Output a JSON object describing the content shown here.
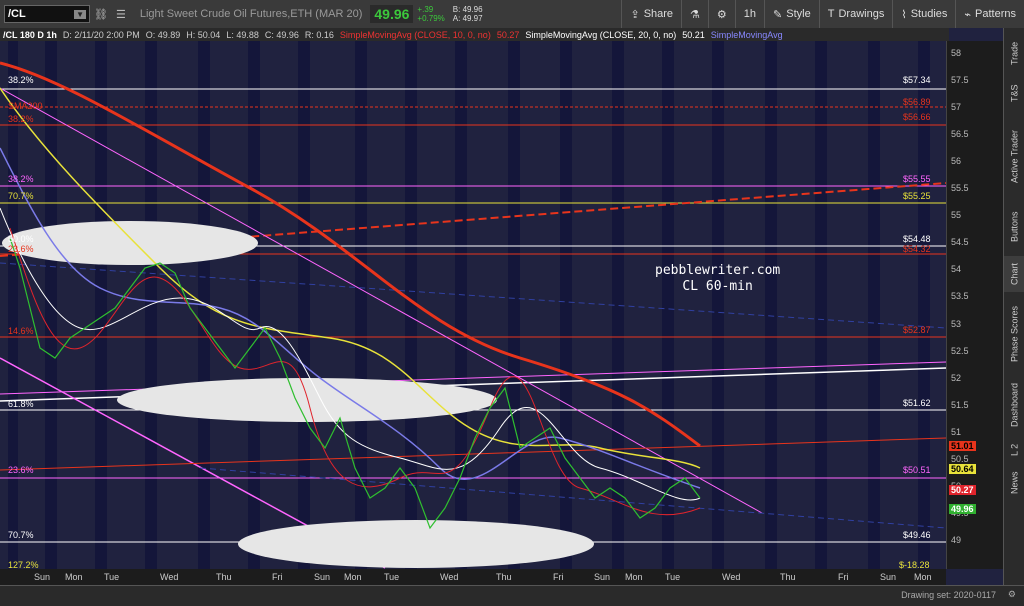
{
  "toolbar": {
    "symbol": "/CL",
    "description": "Light Sweet Crude Oil Futures,ETH (MAR 20)",
    "last_price": "49.96",
    "change": "+.39",
    "change_pct": "+0.79%",
    "bid": "B: 49.96",
    "ask": "A: 49.97",
    "share_label": "Share",
    "interval_label": "1h",
    "style_label": "Style",
    "drawings_label": "Drawings",
    "studies_label": "Studies",
    "patterns_label": "Patterns"
  },
  "header": {
    "title": "/CL 180 D 1h",
    "date": "D: 2/11/20 2:00 PM",
    "open": "O: 49.89",
    "high": "H: 50.04",
    "low": "L: 49.88",
    "close": "C: 49.96",
    "range": "R: 0.16",
    "sma10": "SimpleMovingAvg (CLOSE, 10, 0, no)",
    "sma10_val": "50.27",
    "sma20": "SimpleMovingAvg (CLOSE, 20, 0, no)",
    "sma20_val": "50.21",
    "sma50": "SimpleMovingAvg"
  },
  "price_axis": {
    "ticks": [
      "58",
      "57.5",
      "57",
      "56.5",
      "56",
      "55.5",
      "55",
      "54.5",
      "54",
      "53.5",
      "53",
      "52.5",
      "52",
      "51.5",
      "51",
      "50.5",
      "50",
      "49.5",
      "49"
    ],
    "tags": [
      {
        "text": "51.01",
        "color": "#e8341c"
      },
      {
        "text": "50.64",
        "color": "#e8e23a"
      },
      {
        "text": "50.27",
        "color": "#e0242c"
      },
      {
        "text": "49.96",
        "color": "#30b030"
      }
    ]
  },
  "chart_labels": {
    "left": [
      {
        "text": "38.2%",
        "color": "#ffffff"
      },
      {
        "text": "SMA200",
        "color": "#e8341c"
      },
      {
        "text": "38.2%",
        "color": "#e8341c"
      },
      {
        "text": "38.2%",
        "color": "#ff66ff"
      },
      {
        "text": "70.7%",
        "color": "#e8e23a"
      },
      {
        "text": "50.0%",
        "color": "#ffffff"
      },
      {
        "text": "23.6%",
        "color": "#e8341c"
      },
      {
        "text": "14.6%",
        "color": "#e8341c"
      },
      {
        "text": "61.8%",
        "color": "#ffffff"
      },
      {
        "text": "23.6%",
        "color": "#ff66ff"
      },
      {
        "text": "70.7%",
        "color": "#ffffff"
      },
      {
        "text": "127.2%",
        "color": "#e8e23a"
      }
    ],
    "right": [
      {
        "text": "$57.34",
        "color": "#ffffff"
      },
      {
        "text": "$56.89",
        "color": "#e8341c"
      },
      {
        "text": "$56.66",
        "color": "#e8341c"
      },
      {
        "text": "$55.55",
        "color": "#ff66ff"
      },
      {
        "text": "$55.25",
        "color": "#e8e23a"
      },
      {
        "text": "$54.48",
        "color": "#ffffff"
      },
      {
        "text": "$54.32",
        "color": "#e8341c"
      },
      {
        "text": "$52.87",
        "color": "#e8341c"
      },
      {
        "text": "$51.62",
        "color": "#ffffff"
      },
      {
        "text": "$50.51",
        "color": "#ff66ff"
      },
      {
        "text": "$49.46",
        "color": "#ffffff"
      },
      {
        "text": "$-18.28",
        "color": "#e8e23a"
      }
    ],
    "watermark_line1": "pebblewriter.com",
    "watermark_line2": "CL 60-min"
  },
  "x_axis": [
    "Sun",
    "Mon",
    "Tue",
    "Wed",
    "Thu",
    "Fri",
    "Sun",
    "Mon",
    "Tue",
    "Wed",
    "Thu",
    "Fri",
    "Sun",
    "Mon",
    "Tue",
    "Wed",
    "Thu",
    "Fri",
    "Sun",
    "Mon"
  ],
  "right_tabs": [
    "Trade",
    "T&S",
    "Active Trader",
    "Buttons",
    "Chart",
    "Phase Scores",
    "Dashboard",
    "L 2",
    "News"
  ],
  "status": {
    "drawing_set": "Drawing set: 2020-0117"
  }
}
